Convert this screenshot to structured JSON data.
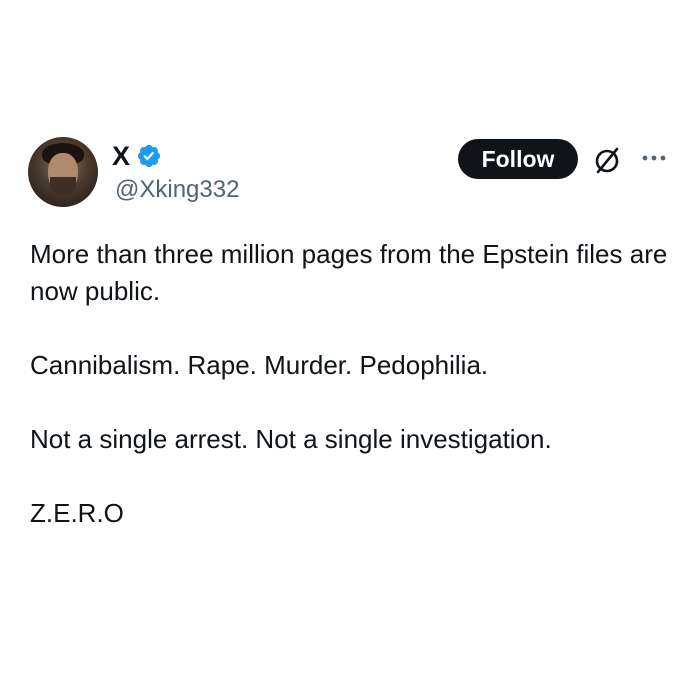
{
  "author": {
    "display_name": "X",
    "handle": "@Xking332",
    "verified": true,
    "verified_color": "#1d9bf0"
  },
  "actions": {
    "follow_label": "Follow",
    "grok_icon": "grok-icon",
    "more_icon": "more-icon"
  },
  "tweet": {
    "paragraphs": [
      "More than three million pages from the Epstein files are now public.",
      "Cannibalism. Rape. Murder. Pedophilia.",
      "Not a single arrest. Not a single investigation.",
      "Z.E.R.O"
    ]
  },
  "colors": {
    "text": "#0f1419",
    "secondary_text": "#536471",
    "button_bg": "#0f1419",
    "button_text": "#ffffff"
  }
}
